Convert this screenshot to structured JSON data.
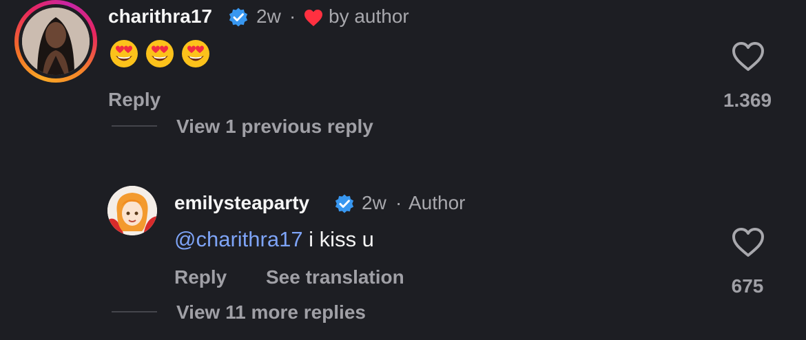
{
  "comments": [
    {
      "username": "charithra17",
      "time": "2w",
      "separator": "·",
      "liked_label": "by author",
      "emoji_text": "😍😍😍",
      "reply_label": "Reply",
      "like_count": "1.369",
      "view_replies_label": "View 1 previous reply"
    },
    {
      "username": "emilysteaparty",
      "time": "2w",
      "separator": "·",
      "role": "Author",
      "mention": "@charithra17",
      "text": " i kiss u",
      "reply_label": "Reply",
      "translate_label": "See translation",
      "like_count": "675",
      "view_replies_label": "View 11 more replies"
    }
  ],
  "colors": {
    "background": "#1d1e23",
    "verified": "#3897f0",
    "heart_red": "#ff3040",
    "mention": "#7ea4f7",
    "muted": "#a8a8ad"
  },
  "icons": [
    "verified-badge-icon",
    "red-heart-icon",
    "like-heart-icon",
    "heart-eyes-emoji"
  ]
}
